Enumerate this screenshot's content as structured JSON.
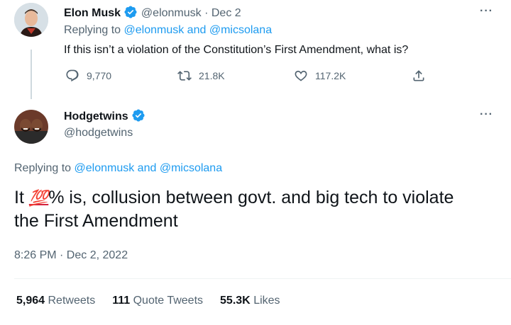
{
  "parent_tweet": {
    "name": "Elon Musk",
    "handle": "@elonmusk",
    "separator": "·",
    "date": "Dec 2",
    "replying_prefix": "Replying to",
    "reply_user1": "@elonmusk",
    "reply_and": "and",
    "reply_user2": "@micsolana",
    "text": "If this isn’t a violation of the Constitution’s First Amendment, what is?",
    "more": "···",
    "actions": {
      "replies": "9,770",
      "retweets": "21.8K",
      "likes": "117.2K"
    }
  },
  "main_tweet": {
    "name": "Hodgetwins",
    "handle": "@hodgetwins",
    "more": "···",
    "replying_prefix": "Replying to",
    "reply_user1": "@elonmusk",
    "reply_and": "and",
    "reply_user2": "@micsolana",
    "text_before": "It ",
    "emoji": "💯",
    "text_after": "% is, collusion between govt. and big tech to violate the First Amendment",
    "timestamp": "8:26 PM · Dec 2, 2022",
    "stats": {
      "retweets_count": "5,964",
      "retweets_label": "Retweets",
      "quotes_count": "111",
      "quotes_label": "Quote Tweets",
      "likes_count": "55.3K",
      "likes_label": "Likes"
    }
  },
  "colors": {
    "accent": "#1d9bf0",
    "text": "#0f1419",
    "secondary": "#536471",
    "divider": "#eff3f4"
  }
}
